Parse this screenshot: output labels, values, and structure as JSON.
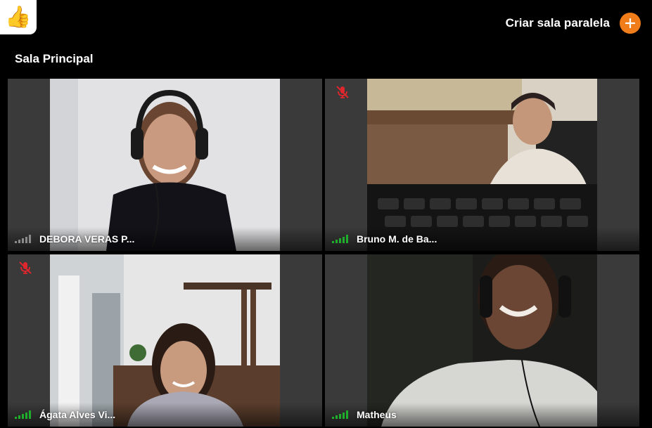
{
  "header": {
    "reaction_icon": "thumbs-up-icon",
    "reaction_glyph": "👍",
    "breakout_label": "Criar sala paralela",
    "breakout_icon": "plus-icon",
    "accent_color": "#f07d1a"
  },
  "room": {
    "title": "Sala Principal"
  },
  "participants": [
    {
      "name": "DEBORA VERAS P...",
      "muted": false,
      "signal": "weak",
      "signal_color": "#8a8a8a"
    },
    {
      "name": "Bruno M. de Ba...",
      "muted": true,
      "signal": "strong",
      "signal_color": "#1fae2b"
    },
    {
      "name": "Ágata Alves Vi...",
      "muted": true,
      "signal": "strong",
      "signal_color": "#1fae2b"
    },
    {
      "name": "Matheus",
      "muted": false,
      "signal": "strong",
      "signal_color": "#1fae2b"
    }
  ]
}
